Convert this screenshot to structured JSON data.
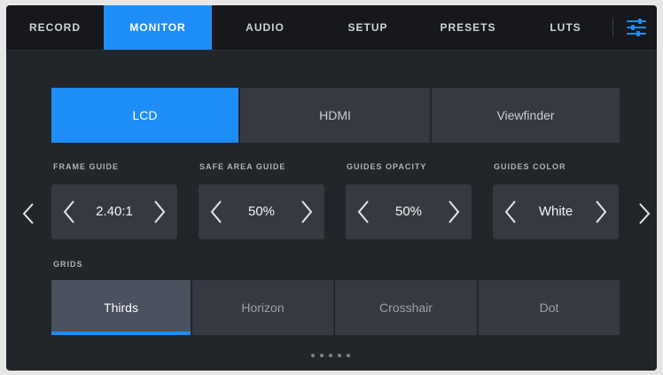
{
  "tabs": [
    {
      "label": "RECORD"
    },
    {
      "label": "MONITOR"
    },
    {
      "label": "AUDIO"
    },
    {
      "label": "SETUP"
    },
    {
      "label": "PRESETS"
    },
    {
      "label": "LUTS"
    }
  ],
  "active_tab": "MONITOR",
  "menu_icon": "sliders-icon",
  "outputs": [
    {
      "label": "LCD"
    },
    {
      "label": "HDMI"
    },
    {
      "label": "Viewfinder"
    }
  ],
  "active_output": "LCD",
  "settings": {
    "frame_guide": {
      "label": "FRAME GUIDE",
      "value": "2.40:1"
    },
    "safe_area_guide": {
      "label": "SAFE AREA GUIDE",
      "value": "50%"
    },
    "guides_opacity": {
      "label": "GUIDES OPACITY",
      "value": "50%"
    },
    "guides_color": {
      "label": "GUIDES COLOR",
      "value": "White"
    }
  },
  "grids": {
    "label": "GRIDS",
    "options": [
      {
        "label": "Thirds"
      },
      {
        "label": "Horizon"
      },
      {
        "label": "Crosshair"
      },
      {
        "label": "Dot"
      }
    ],
    "selected": "Thirds"
  },
  "pagination": {
    "pages": 5,
    "current": 1
  },
  "colors": {
    "accent": "#1e8df5",
    "panel": "#353a41",
    "background": "#222529"
  }
}
